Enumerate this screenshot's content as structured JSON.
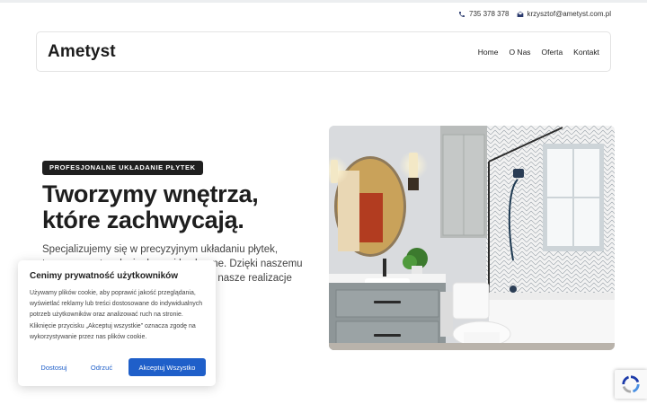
{
  "contact": {
    "phone": "735 378 378",
    "email": "krzysztof@ametyst.com.pl",
    "phone_icon": "phone-icon",
    "email_icon": "envelope-icon"
  },
  "header": {
    "logo": "Ametyst",
    "nav": [
      "Home",
      "O Nas",
      "Oferta",
      "Kontakt"
    ]
  },
  "hero": {
    "badge": "PROFESJONALNE UKŁADANIE PŁYTEK",
    "title_line1": "Tworzymy wnętrza,",
    "title_line2": "które zachwycają.",
    "description": "Specjalizujemy się w precyzyjnym układaniu płytek, tworząc wnętrza łazienkowe i kuchenne. Dzięki naszemu doświadczeniu i dbałości o szczegóły, nasze realizacje trwały na lata.",
    "image": "bathroom-photo"
  },
  "cookie": {
    "title": "Cenimy prywatność użytkowników",
    "text": "Używamy plików cookie, aby poprawić jakość przeglądania, wyświetlać reklamy lub treści dostosowane do indywidualnych potrzeb użytkowników oraz analizować ruch na stronie. Kliknięcie przycisku „Akceptuj wszystkie” oznacza zgodę na wykorzystywanie przez nas plików cookie.",
    "settings_label": "Dostosuj",
    "reject_label": "Odrzuć",
    "accept_label": "Akceptuj Wszystko",
    "accent": "#1f5fc9"
  },
  "recaptcha": {
    "icon": "recaptcha-icon"
  }
}
